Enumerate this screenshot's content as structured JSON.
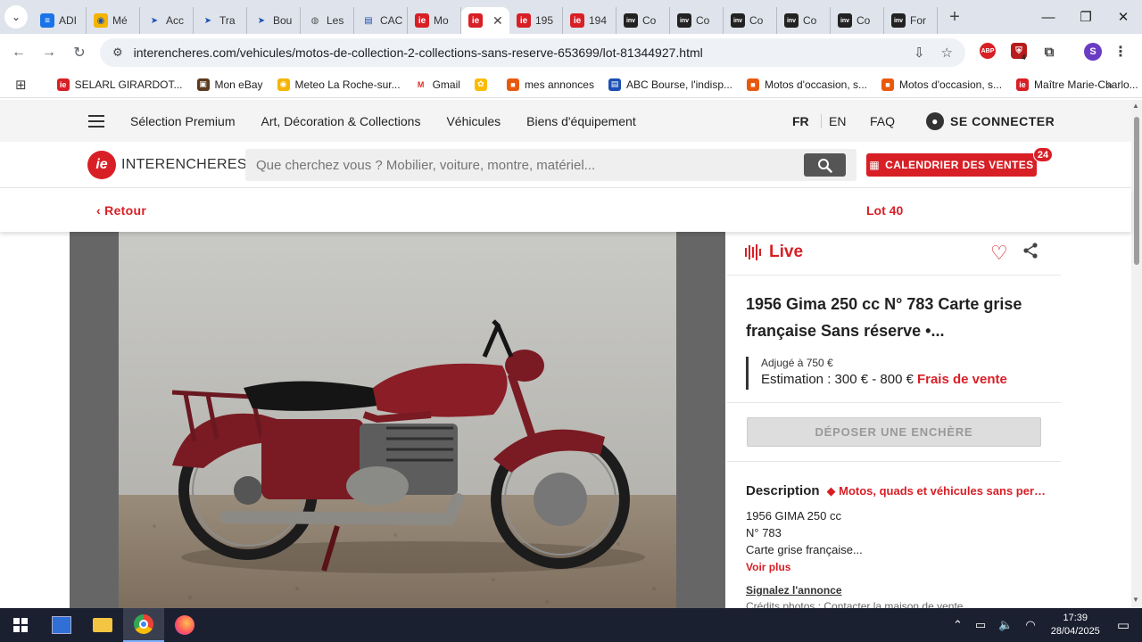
{
  "browser": {
    "tabs": [
      {
        "title": "ADI",
        "fav": "≡",
        "fav_bg": "#1a73e8",
        "fav_fg": "#ffffff"
      },
      {
        "title": "Mé",
        "fav": "◉",
        "fav_bg": "#f5b400",
        "fav_fg": "#1a4fb5"
      },
      {
        "title": "Acc",
        "fav": "➤",
        "fav_bg": "transparent",
        "fav_fg": "#1a4fb5"
      },
      {
        "title": "Tra",
        "fav": "➤",
        "fav_bg": "transparent",
        "fav_fg": "#1a4fb5"
      },
      {
        "title": "Bou",
        "fav": "➤",
        "fav_bg": "transparent",
        "fav_fg": "#1a4fb5"
      },
      {
        "title": "Les",
        "fav": "◍",
        "fav_bg": "transparent",
        "fav_fg": "#555555"
      },
      {
        "title": "CAC",
        "fav": "▤",
        "fav_bg": "transparent",
        "fav_fg": "#1a4fb5"
      },
      {
        "title": "Mo",
        "fav": "ie",
        "fav_bg": "#d81f26",
        "fav_fg": "#ffffff"
      },
      {
        "title": "",
        "fav": "ie",
        "fav_bg": "#d81f26",
        "fav_fg": "#ffffff",
        "active": true
      },
      {
        "title": "195",
        "fav": "ie",
        "fav_bg": "#d81f26",
        "fav_fg": "#ffffff"
      },
      {
        "title": "194",
        "fav": "ie",
        "fav_bg": "#d81f26",
        "fav_fg": "#ffffff"
      },
      {
        "title": "Co",
        "fav": "inv",
        "fav_bg": "#222222",
        "fav_fg": "#ffffff"
      },
      {
        "title": "Co",
        "fav": "inv",
        "fav_bg": "#222222",
        "fav_fg": "#ffffff"
      },
      {
        "title": "Co",
        "fav": "inv",
        "fav_bg": "#222222",
        "fav_fg": "#ffffff"
      },
      {
        "title": "Co",
        "fav": "inv",
        "fav_bg": "#222222",
        "fav_fg": "#ffffff"
      },
      {
        "title": "Co",
        "fav": "inv",
        "fav_bg": "#222222",
        "fav_fg": "#ffffff"
      },
      {
        "title": "For",
        "fav": "inv",
        "fav_bg": "#222222",
        "fav_fg": "#ffffff"
      }
    ],
    "url": "interencheres.com/vehicules/motos-de-collection-2-collections-sans-reserve-653699/lot-81344927.html",
    "profile_initial": "S",
    "abp_label": "ABP",
    "ext_badge": "4",
    "bookmarks": [
      {
        "label": "SELARL GIRARDOT...",
        "icon_bg": "#d81f26",
        "icon": "ie"
      },
      {
        "label": "Mon eBay",
        "icon_bg": "#5b3a1e",
        "icon": "▣"
      },
      {
        "label": "Meteo La Roche-sur...",
        "icon_bg": "#f5b400",
        "icon": "◉"
      },
      {
        "label": "Gmail",
        "icon_bg": "#ffffff",
        "icon": "M"
      },
      {
        "label": "",
        "icon_bg": "#fbbc04",
        "icon": "✿"
      },
      {
        "label": "mes annonces",
        "icon_bg": "#e8590c",
        "icon": "■"
      },
      {
        "label": "ABC Bourse, l'indisp...",
        "icon_bg": "#1a4fb5",
        "icon": "▤"
      },
      {
        "label": "Motos d'occasion, s...",
        "icon_bg": "#e8590c",
        "icon": "■"
      },
      {
        "label": "Motos d'occasion, s...",
        "icon_bg": "#e8590c",
        "icon": "■"
      },
      {
        "label": "Maître Marie-Charlo...",
        "icon_bg": "#d81f26",
        "icon": "ie"
      }
    ]
  },
  "site": {
    "nav": [
      "Sélection Premium",
      "Art, Décoration & Collections",
      "Véhicules",
      "Biens d'équipement"
    ],
    "lang_active": "FR",
    "lang_other": "EN",
    "faq": "FAQ",
    "login": "SE CONNECTER",
    "logo_mark": "ie",
    "logo_text": "INTERENCHERES",
    "search_placeholder": "Que cherchez vous ? Mobilier, voiture, montre, matériel...",
    "calendar_label": "CALENDRIER DES VENTES",
    "calendar_badge": "24",
    "back_label": "Retour",
    "lot_label": "Lot 40"
  },
  "lot": {
    "live_label": "Live",
    "title": "1956 Gima 250 cc N° 783 Carte grise française Sans réserve •...",
    "adjuge": "Adjugé à 750 €",
    "estimation": "Estimation : 300 € - 800 €",
    "frais": "Frais de vente",
    "bid_button": "DÉPOSER UNE ENCHÈRE",
    "description_heading": "Description",
    "category": "Motos, quads et véhicules sans permis",
    "desc_lines": [
      "1956 GIMA 250 cc",
      "N° 783",
      "Carte grise française..."
    ],
    "voir_plus": "Voir plus",
    "signal": "Signalez l'annonce",
    "credits": "Crédits photos : Contacter la maison de vente"
  },
  "taskbar": {
    "time": "17:39",
    "date": "28/04/2025"
  },
  "colors": {
    "brand_red": "#d81f26",
    "bike_red": "#7a1a22"
  }
}
